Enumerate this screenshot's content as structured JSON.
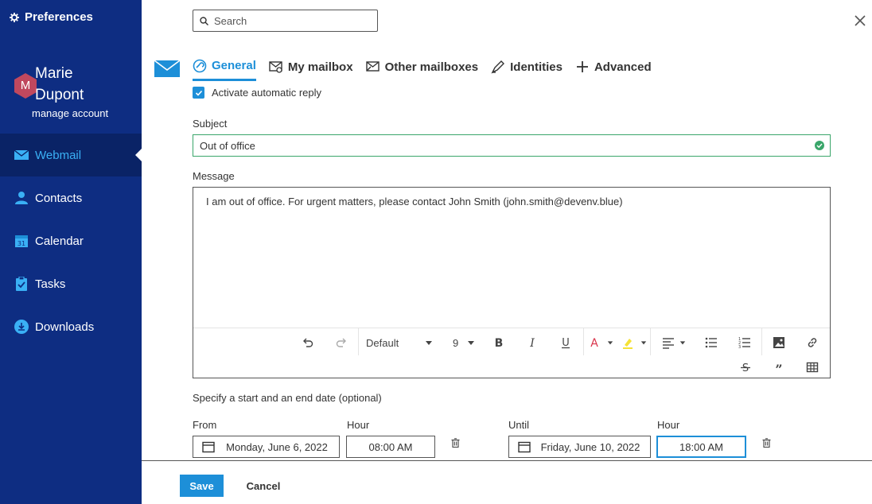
{
  "sidebar": {
    "title": "Preferences",
    "user": {
      "initial": "M",
      "first_name": "Marie",
      "last_name": "Dupont",
      "manage": "manage account"
    },
    "items": [
      {
        "label": "Webmail",
        "icon": "envelope-icon",
        "active": true
      },
      {
        "label": "Contacts",
        "icon": "user-icon"
      },
      {
        "label": "Calendar",
        "icon": "calendar-icon"
      },
      {
        "label": "Tasks",
        "icon": "clipboard-icon"
      },
      {
        "label": "Downloads",
        "icon": "download-icon"
      }
    ]
  },
  "search": {
    "placeholder": "Search"
  },
  "tabs": [
    {
      "label": "General",
      "icon": "general-icon",
      "active": true
    },
    {
      "label": "My mailbox",
      "icon": "mailbox-icon"
    },
    {
      "label": "Other mailboxes",
      "icon": "other-mailboxes-icon"
    },
    {
      "label": "Identities",
      "icon": "identities-icon"
    },
    {
      "label": "Advanced",
      "icon": "plus-icon"
    }
  ],
  "form": {
    "auto_reply_label": "Activate automatic reply",
    "auto_reply_checked": true,
    "subject_label": "Subject",
    "subject_value": "Out of office",
    "message_label": "Message",
    "message_value": "I am out of office. For urgent matters, please contact John Smith (john.smith@devenv.blue)",
    "toolbar": {
      "font": "Default",
      "size": "9"
    },
    "date_section_label": "Specify a start and an end date (optional)",
    "from_label": "From",
    "from_date": "Monday, June 6, 2022",
    "from_hour_label": "Hour",
    "from_hour": "08:00 AM",
    "until_label": "Until",
    "until_date": "Friday, June 10, 2022",
    "until_hour_label": "Hour",
    "until_hour": "18:00 AM"
  },
  "footer": {
    "save": "Save",
    "cancel": "Cancel"
  },
  "colors": {
    "sidebar": "#0e2d82",
    "accent": "#1d8fd8",
    "valid": "#3aa66a",
    "avatar": "#c0485e"
  }
}
